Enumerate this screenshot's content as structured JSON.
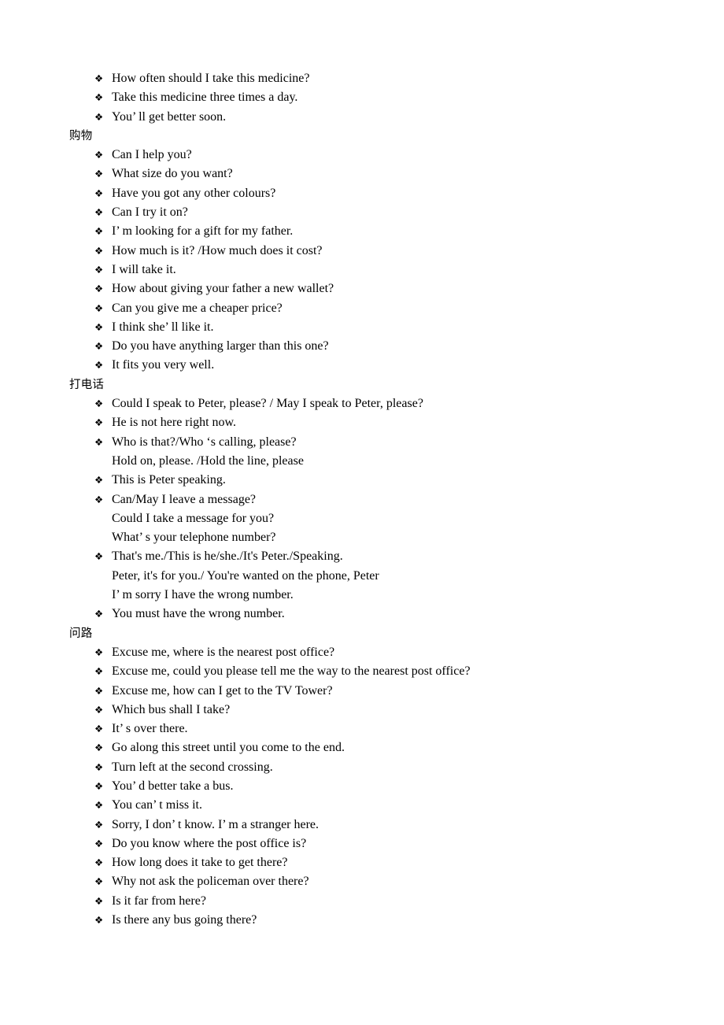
{
  "document": {
    "page_background": "#ffffff",
    "text_color": "#000000",
    "bullet_glyph": "❖",
    "bullet_icon_name": "diamond-bullet-icon"
  },
  "sections": [
    {
      "heading": null,
      "heading_id": "seeing-a-doctor-continued",
      "lines": [
        {
          "bullet": true,
          "text": "How often should I take this medicine?"
        },
        {
          "bullet": true,
          "text": "Take this medicine three times a day."
        },
        {
          "bullet": true,
          "text": "You’ ll get better soon."
        }
      ]
    },
    {
      "heading": "购物",
      "heading_id": "shopping",
      "lines": [
        {
          "bullet": true,
          "text": "Can I help you?"
        },
        {
          "bullet": true,
          "text": "What size do you want?"
        },
        {
          "bullet": true,
          "text": "Have you got any other colours?"
        },
        {
          "bullet": true,
          "text": "Can I try it on?"
        },
        {
          "bullet": true,
          "text": "I’ m looking for a gift for my father."
        },
        {
          "bullet": true,
          "text": "How much is it? /How much does it cost?"
        },
        {
          "bullet": true,
          "text": "I will take it."
        },
        {
          "bullet": true,
          "text": "How about giving your father a new wallet?"
        },
        {
          "bullet": true,
          "text": "Can you give me a cheaper price?"
        },
        {
          "bullet": true,
          "text": "I think she’ ll like it."
        },
        {
          "bullet": true,
          "text": "Do you have anything larger than this one?"
        },
        {
          "bullet": true,
          "text": "It fits you very well."
        }
      ]
    },
    {
      "heading": "打电话",
      "heading_id": "making-a-phone-call",
      "lines": [
        {
          "bullet": true,
          "text": "Could I speak to Peter, please? / May I speak to Peter, please?"
        },
        {
          "bullet": true,
          "text": "He is not here right now."
        },
        {
          "bullet": true,
          "text": "Who is that?/Who ‘s calling, please?"
        },
        {
          "bullet": false,
          "text": "Hold on, please. /Hold the line, please"
        },
        {
          "bullet": true,
          "text": "This is Peter speaking."
        },
        {
          "bullet": true,
          "text": "Can/May I leave a message?"
        },
        {
          "bullet": false,
          "text": "Could I take a message for you?"
        },
        {
          "bullet": false,
          "text": "What’ s your telephone number?"
        },
        {
          "bullet": true,
          "text": "That's me./This is he/she./It's Peter./Speaking."
        },
        {
          "bullet": false,
          "text": "Peter, it's for you./ You're wanted on the phone, Peter"
        },
        {
          "bullet": false,
          "text": "I’ m sorry I have the wrong number."
        },
        {
          "bullet": true,
          "text": "You must have the wrong number."
        }
      ]
    },
    {
      "heading": "问路",
      "heading_id": "asking-the-way",
      "lines": [
        {
          "bullet": true,
          "text": "Excuse me, where is the nearest post office?"
        },
        {
          "bullet": true,
          "text": "Excuse me, could you please tell me the way to the nearest post office?"
        },
        {
          "bullet": true,
          "text": "Excuse me, how can I get to the TV Tower?"
        },
        {
          "bullet": true,
          "text": "Which bus shall I take?"
        },
        {
          "bullet": true,
          "text": "It’ s over there."
        },
        {
          "bullet": true,
          "text": "Go along this street until you come to the end."
        },
        {
          "bullet": true,
          "text": "Turn left at the second crossing."
        },
        {
          "bullet": true,
          "text": "You’ d better take a bus."
        },
        {
          "bullet": true,
          "text": "You can’ t miss it."
        },
        {
          "bullet": true,
          "text": "Sorry, I don’ t know. I’ m a stranger here."
        },
        {
          "bullet": true,
          "text": "Do you know where the post office is?"
        },
        {
          "bullet": true,
          "text": "How long does it take to get there?"
        },
        {
          "bullet": true,
          "text": "Why not ask the policeman over there?"
        },
        {
          "bullet": true,
          "text": "Is it far from here?"
        },
        {
          "bullet": true,
          "text": "Is there any bus going there?"
        }
      ]
    }
  ]
}
